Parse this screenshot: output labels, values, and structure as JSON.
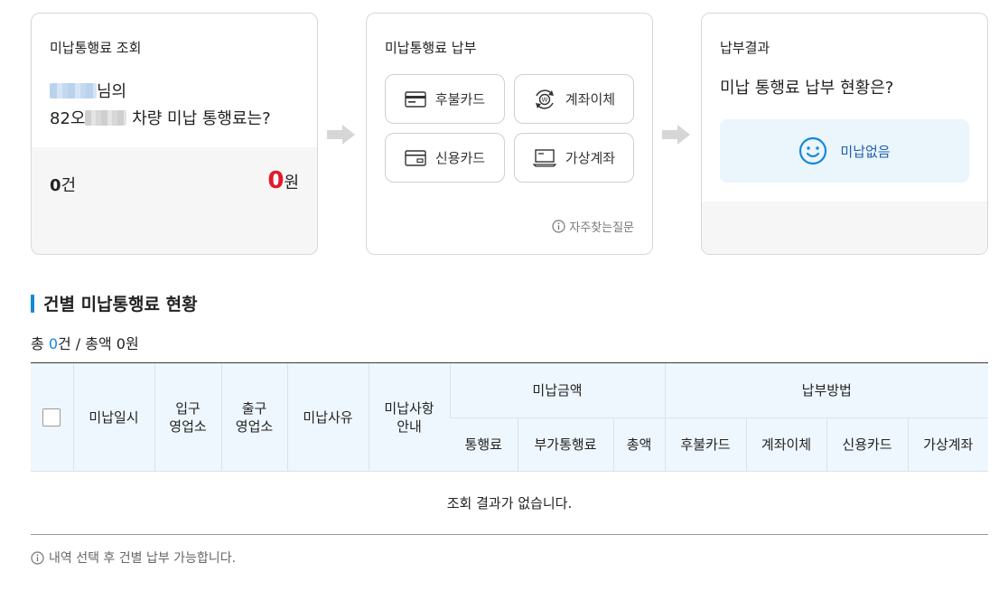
{
  "lookup_card": {
    "title": "미납통행료 조회",
    "owner_suffix": "님의",
    "plate_prefix": "82오",
    "plate_suffix": " 차량 미납 통행료는?",
    "count_value": "0",
    "count_unit": "건",
    "amount_value": "0",
    "amount_unit": "원",
    "amount_color": "#e2192c"
  },
  "payment_card": {
    "title": "미납통행료 납부",
    "methods": [
      {
        "label": "후불카드",
        "icon": "card-icon"
      },
      {
        "label": "계좌이체",
        "icon": "transfer-icon"
      },
      {
        "label": "신용카드",
        "icon": "credit-card-icon"
      },
      {
        "label": "가상계좌",
        "icon": "laptop-icon"
      }
    ],
    "faq_label": "자주찾는질문"
  },
  "result_card": {
    "title": "납부결과",
    "question": "미납 통행료 납부 현황은?",
    "status": "미납없음",
    "status_icon": "smile-icon",
    "accent": "#1588d6"
  },
  "section": {
    "title": "건별 미납통행료 현황",
    "summary_prefix": "총 ",
    "summary_count": "0",
    "summary_rest": "건 / 총액 0원"
  },
  "table": {
    "headers": {
      "date": "미납일시",
      "entry_line1": "입구",
      "entry_line2": "영업소",
      "exit_line1": "출구",
      "exit_line2": "영업소",
      "reason": "미납사유",
      "guide_line1": "미납사항",
      "guide_line2": "안내",
      "amount_group": "미납금액",
      "method_group": "납부방법",
      "toll": "통행료",
      "extra_toll": "부가통행료",
      "total": "총액",
      "postpaid": "후불카드",
      "transfer": "계좌이체",
      "credit": "신용카드",
      "virtual": "가상계좌"
    },
    "empty_message": "조회 결과가 없습니다."
  },
  "footer_note": "내역 선택 후 건별 납부 가능합니다."
}
